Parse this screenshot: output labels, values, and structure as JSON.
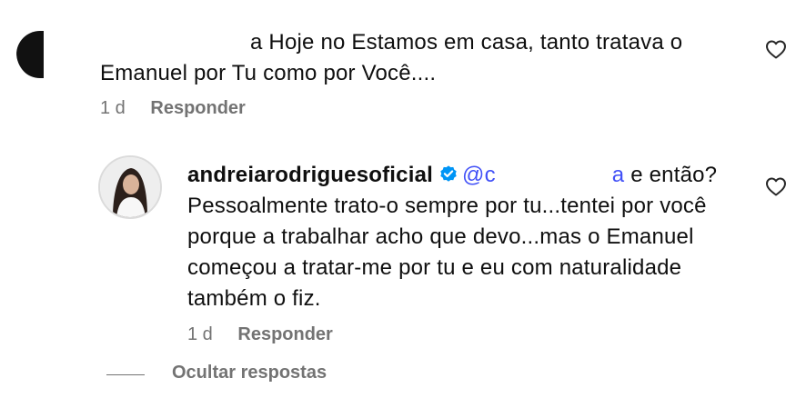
{
  "comment1": {
    "text": "a Hoje no Estamos em casa, tanto tratava o Emanuel por Tu como por Você....",
    "time": "1 d",
    "reply_label": "Responder"
  },
  "reply1": {
    "username": "andreiarodriguesoficial",
    "mention_start": "@c",
    "mention_end": "a",
    "text_after_mention": " e então? Pessoalmente trato-o sempre por tu...tentei por você porque a trabalhar acho que devo...mas o Emanuel começou a tratar-me por tu e eu com naturalidade também o fiz.",
    "time": "1 d",
    "reply_label": "Responder"
  },
  "hide_replies_label": "Ocultar respostas",
  "colors": {
    "verified": "#0095f6",
    "mention": "#4150f7",
    "meta": "#737373"
  },
  "icons": [
    "heart-icon",
    "verified-badge-icon"
  ]
}
